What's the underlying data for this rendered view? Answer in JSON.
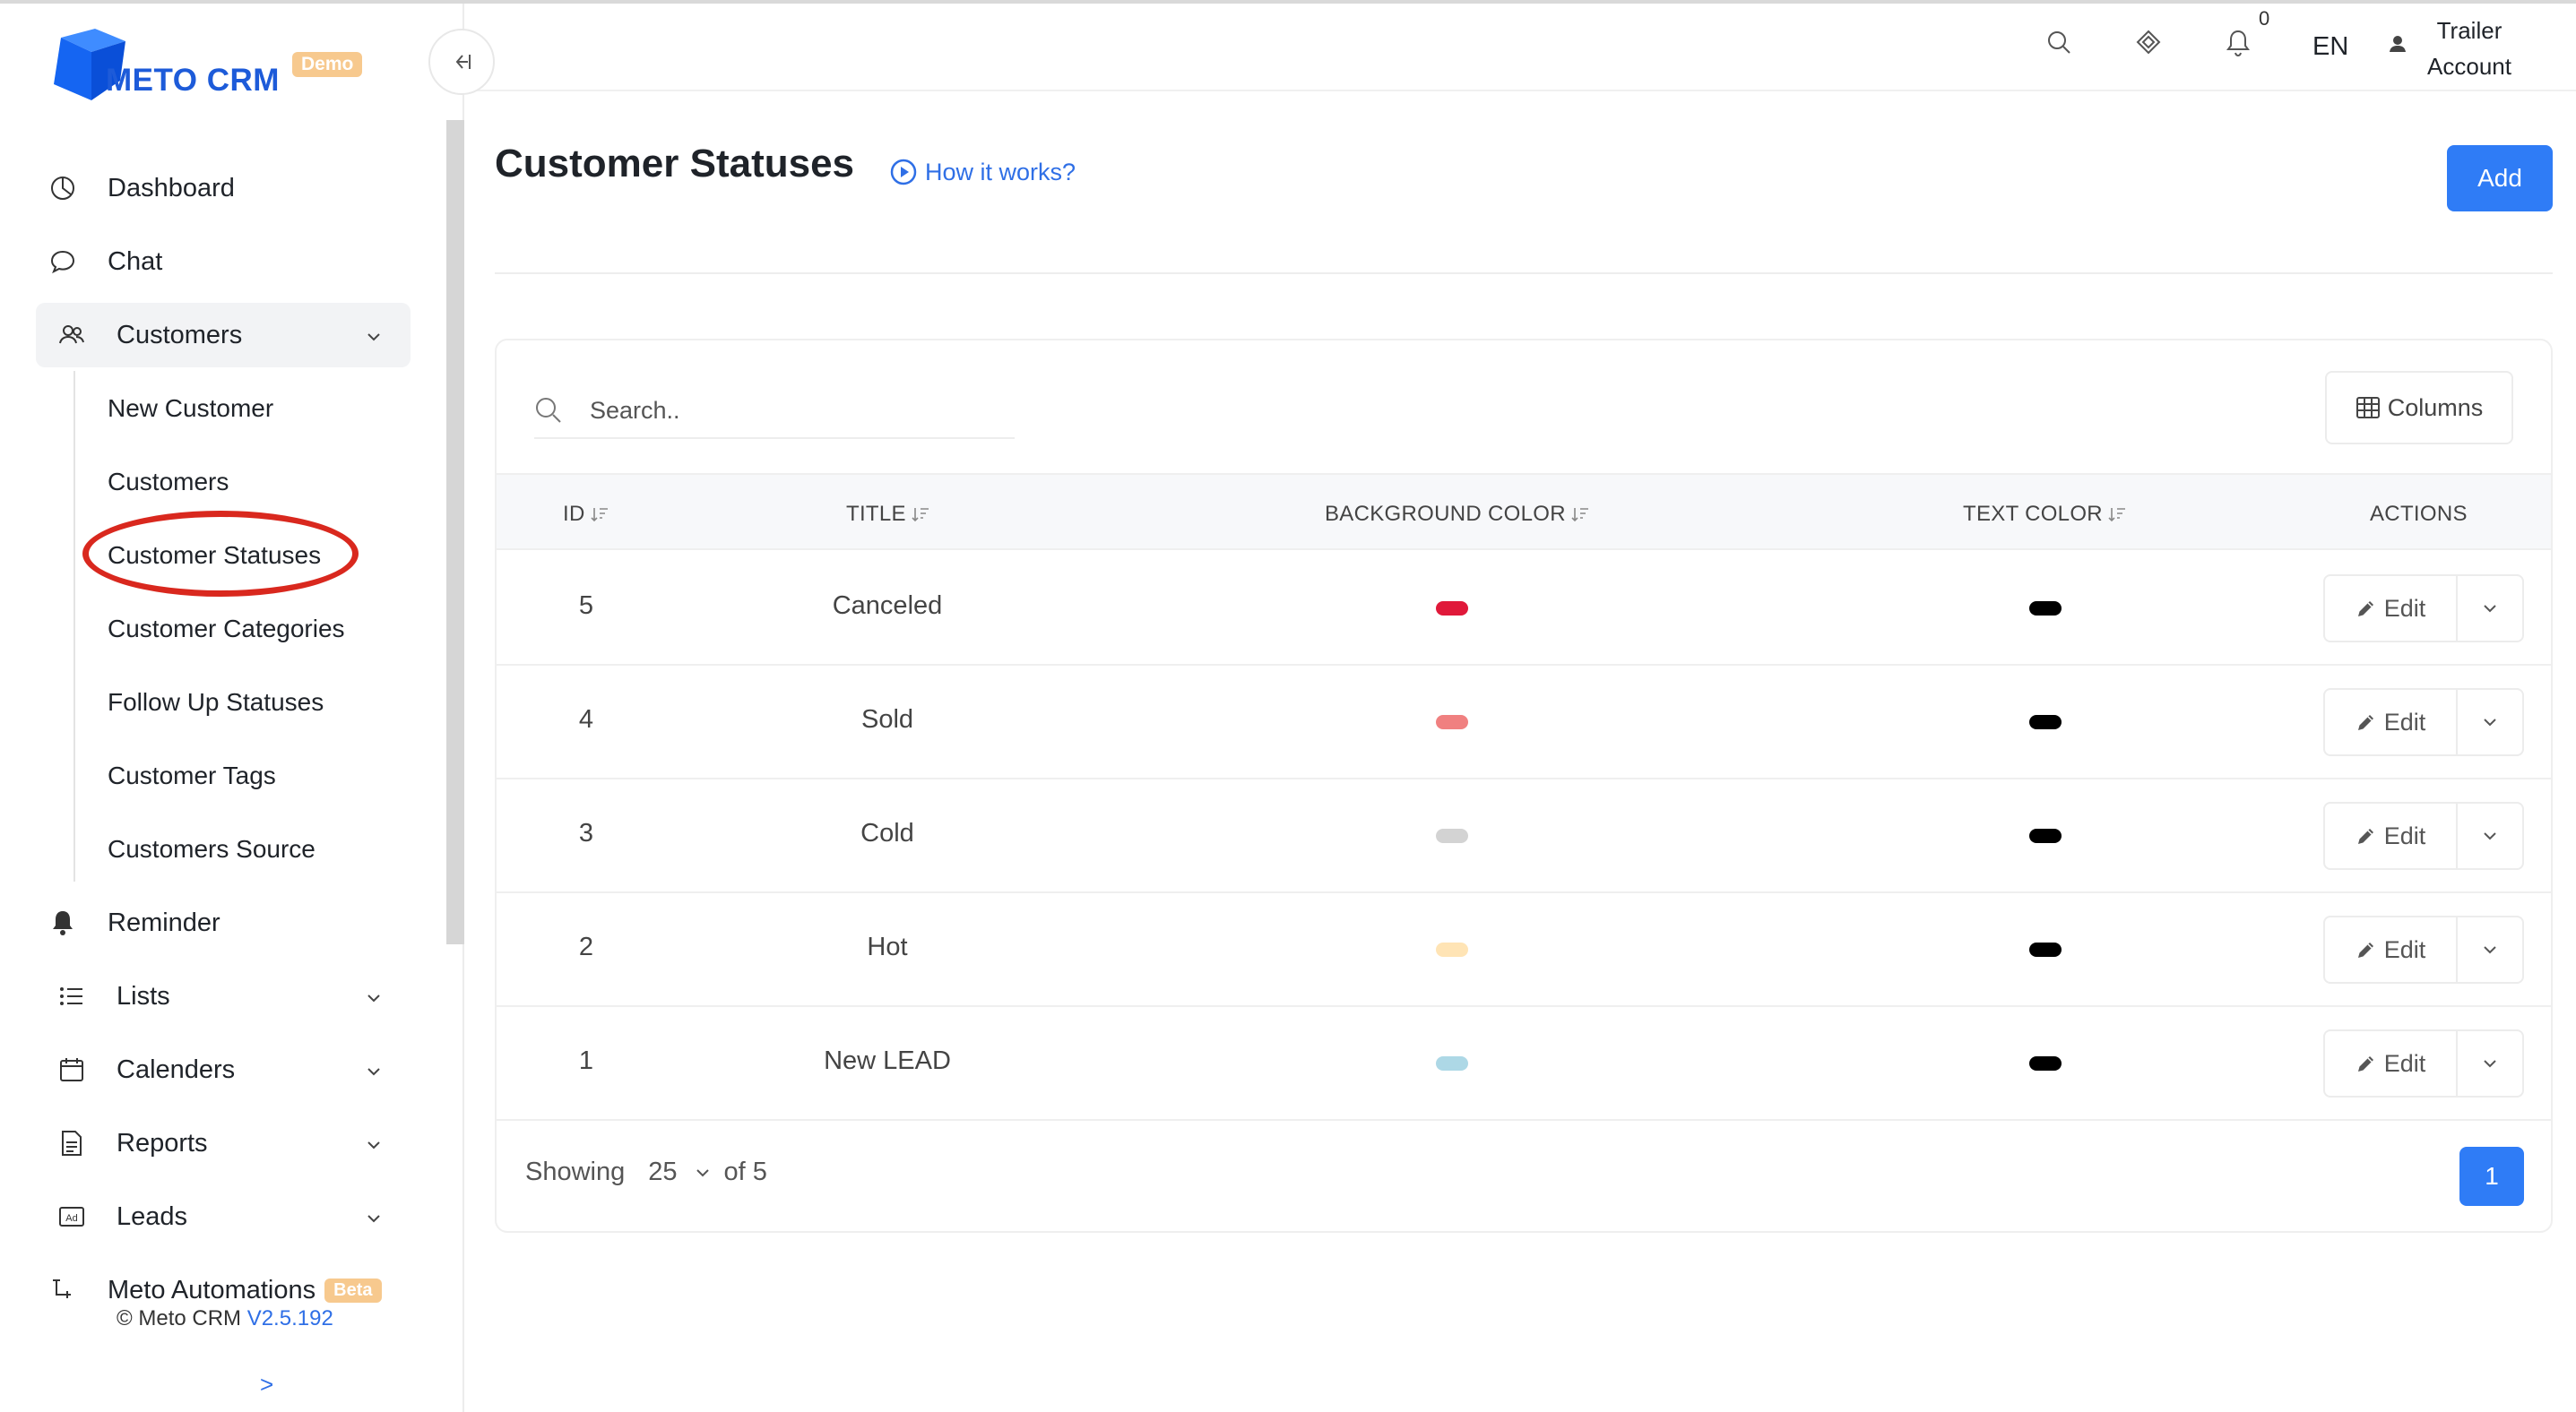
{
  "app": {
    "logo_text": "METO CRM",
    "logo_badge": "Demo",
    "brand_color": "#1d5bd9",
    "accent_color": "#2f7cf6"
  },
  "header": {
    "notification_count": "0",
    "language": "EN",
    "user_line1": "Trailer",
    "user_line2": "Account",
    "icons": [
      "search-icon",
      "diamond-icon",
      "bell-icon",
      "user-icon"
    ]
  },
  "sidebar": {
    "items": [
      {
        "label": "Dashboard",
        "icon": "dashboard-icon"
      },
      {
        "label": "Chat",
        "icon": "chat-icon"
      },
      {
        "label": "Customers",
        "icon": "users-icon",
        "expanded": true
      },
      {
        "label": "Reminder",
        "icon": "bell-icon"
      },
      {
        "label": "Lists",
        "icon": "list-icon"
      },
      {
        "label": "Calenders",
        "icon": "calendar-icon"
      },
      {
        "label": "Reports",
        "icon": "report-icon"
      },
      {
        "label": "Leads",
        "icon": "ad-icon"
      },
      {
        "label": "Meto Automations",
        "icon": "automation-icon",
        "badge": "Beta"
      }
    ],
    "customers_sub": [
      "New Customer",
      "Customers",
      "Customer Statuses",
      "Customer Categories",
      "Follow Up Statuses",
      "Customer Tags",
      "Customers Source"
    ],
    "footer_copy": "© Meto CRM",
    "footer_version": "V2.5.192",
    "footer_arrow": ">"
  },
  "page": {
    "title": "Customer Statuses",
    "how_it_works": "How it works?",
    "add_label": "Add"
  },
  "table": {
    "search_placeholder": "Search..",
    "columns_label": "Columns",
    "headers": {
      "id": "ID",
      "title": "TITLE",
      "bg": "BACKGROUND COLOR",
      "text": "TEXT COLOR",
      "actions": "ACTIONS"
    },
    "rows": [
      {
        "id": "5",
        "title": "Canceled",
        "bg_color": "#e0193a",
        "text_color": "#000000"
      },
      {
        "id": "4",
        "title": "Sold",
        "bg_color": "#f08080",
        "text_color": "#000000"
      },
      {
        "id": "3",
        "title": "Cold",
        "bg_color": "#d3d3d3",
        "text_color": "#000000"
      },
      {
        "id": "2",
        "title": "Hot",
        "bg_color": "#ffe4b5",
        "text_color": "#000000"
      },
      {
        "id": "1",
        "title": "New LEAD",
        "bg_color": "#add8e6",
        "text_color": "#000000"
      }
    ],
    "edit_label": "Edit",
    "showing_label": "Showing",
    "page_size": "25",
    "of_label": "of 5",
    "current_page": "1"
  }
}
